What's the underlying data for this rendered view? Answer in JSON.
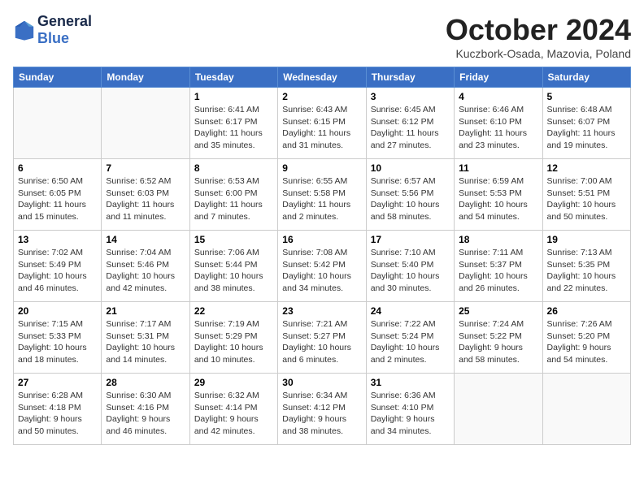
{
  "header": {
    "logo_line1": "General",
    "logo_line2": "Blue",
    "month": "October 2024",
    "location": "Kuczbork-Osada, Mazovia, Poland"
  },
  "days_of_week": [
    "Sunday",
    "Monday",
    "Tuesday",
    "Wednesday",
    "Thursday",
    "Friday",
    "Saturday"
  ],
  "weeks": [
    [
      {
        "day": "",
        "info": ""
      },
      {
        "day": "",
        "info": ""
      },
      {
        "day": "1",
        "info": "Sunrise: 6:41 AM\nSunset: 6:17 PM\nDaylight: 11 hours and 35 minutes."
      },
      {
        "day": "2",
        "info": "Sunrise: 6:43 AM\nSunset: 6:15 PM\nDaylight: 11 hours and 31 minutes."
      },
      {
        "day": "3",
        "info": "Sunrise: 6:45 AM\nSunset: 6:12 PM\nDaylight: 11 hours and 27 minutes."
      },
      {
        "day": "4",
        "info": "Sunrise: 6:46 AM\nSunset: 6:10 PM\nDaylight: 11 hours and 23 minutes."
      },
      {
        "day": "5",
        "info": "Sunrise: 6:48 AM\nSunset: 6:07 PM\nDaylight: 11 hours and 19 minutes."
      }
    ],
    [
      {
        "day": "6",
        "info": "Sunrise: 6:50 AM\nSunset: 6:05 PM\nDaylight: 11 hours and 15 minutes."
      },
      {
        "day": "7",
        "info": "Sunrise: 6:52 AM\nSunset: 6:03 PM\nDaylight: 11 hours and 11 minutes."
      },
      {
        "day": "8",
        "info": "Sunrise: 6:53 AM\nSunset: 6:00 PM\nDaylight: 11 hours and 7 minutes."
      },
      {
        "day": "9",
        "info": "Sunrise: 6:55 AM\nSunset: 5:58 PM\nDaylight: 11 hours and 2 minutes."
      },
      {
        "day": "10",
        "info": "Sunrise: 6:57 AM\nSunset: 5:56 PM\nDaylight: 10 hours and 58 minutes."
      },
      {
        "day": "11",
        "info": "Sunrise: 6:59 AM\nSunset: 5:53 PM\nDaylight: 10 hours and 54 minutes."
      },
      {
        "day": "12",
        "info": "Sunrise: 7:00 AM\nSunset: 5:51 PM\nDaylight: 10 hours and 50 minutes."
      }
    ],
    [
      {
        "day": "13",
        "info": "Sunrise: 7:02 AM\nSunset: 5:49 PM\nDaylight: 10 hours and 46 minutes."
      },
      {
        "day": "14",
        "info": "Sunrise: 7:04 AM\nSunset: 5:46 PM\nDaylight: 10 hours and 42 minutes."
      },
      {
        "day": "15",
        "info": "Sunrise: 7:06 AM\nSunset: 5:44 PM\nDaylight: 10 hours and 38 minutes."
      },
      {
        "day": "16",
        "info": "Sunrise: 7:08 AM\nSunset: 5:42 PM\nDaylight: 10 hours and 34 minutes."
      },
      {
        "day": "17",
        "info": "Sunrise: 7:10 AM\nSunset: 5:40 PM\nDaylight: 10 hours and 30 minutes."
      },
      {
        "day": "18",
        "info": "Sunrise: 7:11 AM\nSunset: 5:37 PM\nDaylight: 10 hours and 26 minutes."
      },
      {
        "day": "19",
        "info": "Sunrise: 7:13 AM\nSunset: 5:35 PM\nDaylight: 10 hours and 22 minutes."
      }
    ],
    [
      {
        "day": "20",
        "info": "Sunrise: 7:15 AM\nSunset: 5:33 PM\nDaylight: 10 hours and 18 minutes."
      },
      {
        "day": "21",
        "info": "Sunrise: 7:17 AM\nSunset: 5:31 PM\nDaylight: 10 hours and 14 minutes."
      },
      {
        "day": "22",
        "info": "Sunrise: 7:19 AM\nSunset: 5:29 PM\nDaylight: 10 hours and 10 minutes."
      },
      {
        "day": "23",
        "info": "Sunrise: 7:21 AM\nSunset: 5:27 PM\nDaylight: 10 hours and 6 minutes."
      },
      {
        "day": "24",
        "info": "Sunrise: 7:22 AM\nSunset: 5:24 PM\nDaylight: 10 hours and 2 minutes."
      },
      {
        "day": "25",
        "info": "Sunrise: 7:24 AM\nSunset: 5:22 PM\nDaylight: 9 hours and 58 minutes."
      },
      {
        "day": "26",
        "info": "Sunrise: 7:26 AM\nSunset: 5:20 PM\nDaylight: 9 hours and 54 minutes."
      }
    ],
    [
      {
        "day": "27",
        "info": "Sunrise: 6:28 AM\nSunset: 4:18 PM\nDaylight: 9 hours and 50 minutes."
      },
      {
        "day": "28",
        "info": "Sunrise: 6:30 AM\nSunset: 4:16 PM\nDaylight: 9 hours and 46 minutes."
      },
      {
        "day": "29",
        "info": "Sunrise: 6:32 AM\nSunset: 4:14 PM\nDaylight: 9 hours and 42 minutes."
      },
      {
        "day": "30",
        "info": "Sunrise: 6:34 AM\nSunset: 4:12 PM\nDaylight: 9 hours and 38 minutes."
      },
      {
        "day": "31",
        "info": "Sunrise: 6:36 AM\nSunset: 4:10 PM\nDaylight: 9 hours and 34 minutes."
      },
      {
        "day": "",
        "info": ""
      },
      {
        "day": "",
        "info": ""
      }
    ]
  ]
}
